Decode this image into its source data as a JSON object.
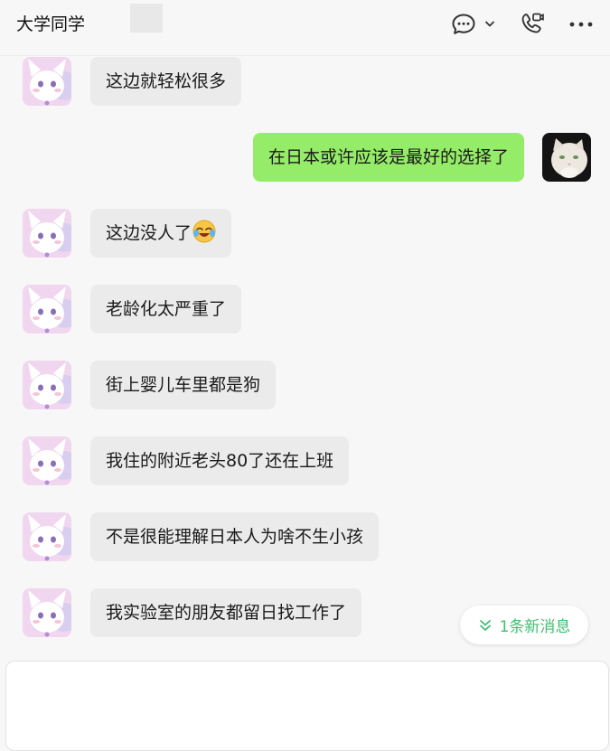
{
  "header": {
    "title": "大学同学",
    "icons": {
      "chat": "chat-bubble-icon",
      "dropdown": "chevron-down-icon",
      "call": "phone-video-icon",
      "more": "more-icon"
    }
  },
  "messages": [
    {
      "side": "left",
      "text": "这边就轻松很多"
    },
    {
      "side": "right",
      "text": "在日本或许应该是最好的选择了"
    },
    {
      "side": "left",
      "text": "这边没人了",
      "emoji": "rolling-laugh-emoji"
    },
    {
      "side": "left",
      "text": "老龄化太严重了"
    },
    {
      "side": "left",
      "text": "街上婴儿车里都是狗"
    },
    {
      "side": "left",
      "text": "我住的附近老头80了还在上班"
    },
    {
      "side": "left",
      "text": "不是很能理解日本人为啥不生小孩"
    },
    {
      "side": "left",
      "text": "我实验室的朋友都留日找工作了"
    }
  ],
  "new_message_pill": {
    "label": "1条新消息",
    "icon": "double-chevron-down-icon"
  },
  "input": {
    "value": ""
  },
  "colors": {
    "bubble_right": "#95ec69",
    "bubble_left": "#ebebeb",
    "accent": "#3fbf72"
  }
}
